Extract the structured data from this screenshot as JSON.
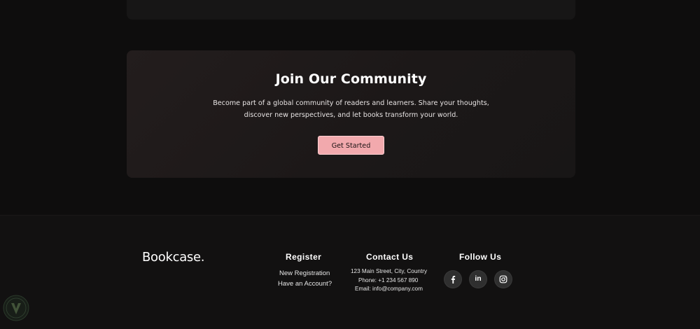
{
  "community": {
    "title": "Join Our Community",
    "description_line1": "Become part of a global community of readers and learners. Share your thoughts,",
    "description_line2": "discover new perspectives, and let books transform your world.",
    "cta_label": "Get Started",
    "cta_color": "#f2a9ad"
  },
  "footer": {
    "brand": "Bookcase.",
    "register": {
      "title": "Register",
      "links": [
        "New Registration",
        "Have an Account?"
      ]
    },
    "contact": {
      "title": "Contact Us",
      "address": "123 Main Street, City, Country",
      "phone": "Phone: +1 234 567 890",
      "email": "Email: info@company.com"
    },
    "follow": {
      "title": "Follow Us",
      "icons": [
        "facebook-icon",
        "linkedin-icon",
        "instagram-icon"
      ],
      "linkedin_text": "in"
    }
  },
  "colors": {
    "background": "#0e0d0d",
    "card": "#1c1818",
    "accent": "#f2a9ad"
  }
}
